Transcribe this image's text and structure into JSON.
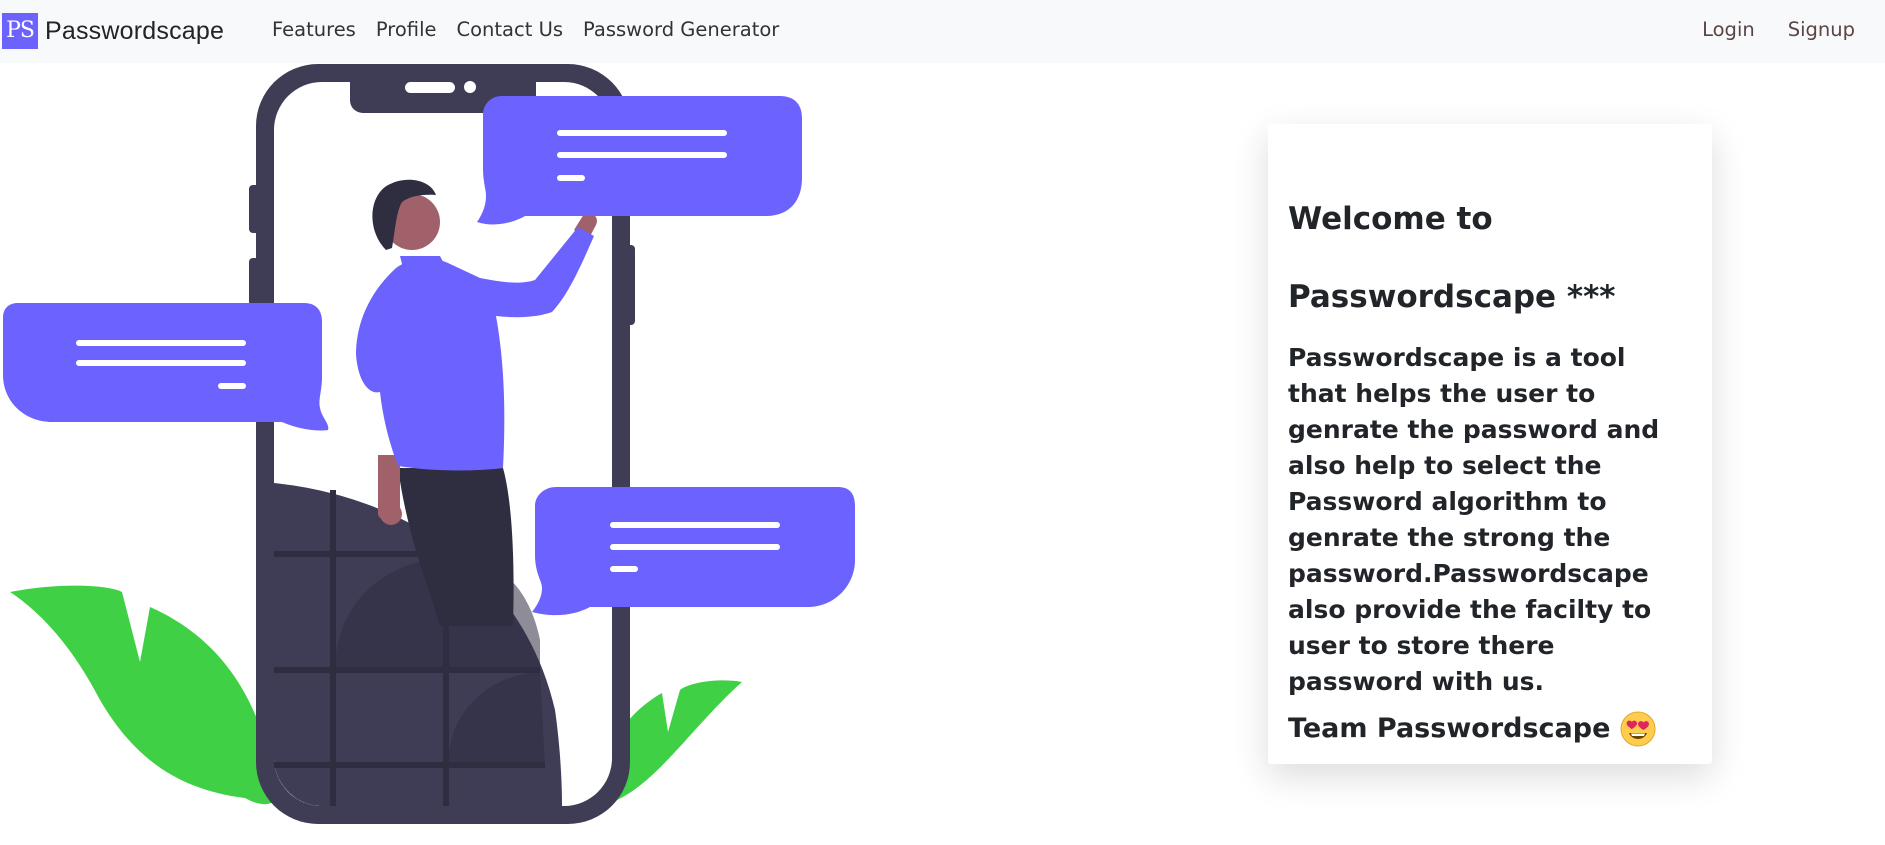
{
  "brand": {
    "logo_text": "PS",
    "name": "Passwordscape"
  },
  "nav": {
    "links": [
      {
        "label": "Features"
      },
      {
        "label": "Profile"
      },
      {
        "label": "Contact Us"
      },
      {
        "label": "Password Generator"
      }
    ],
    "auth": {
      "login": "Login",
      "signup": "Signup"
    }
  },
  "card": {
    "title_line1": "Welcome to",
    "title_line2": "Passwordscape ***",
    "body": "Passwordscape is a tool that helps the user to genrate the password and also help to select the Password algorithm to genrate the strong the password.Passwordscape also provide the facilty to user to store there password with us.",
    "signoff": "Team Passwordscape",
    "signoff_emoji": "smiling-face-with-heart-eyes-icon"
  },
  "colors": {
    "accent": "#6c63ff",
    "phone": "#3f3d56",
    "leaf": "#3fd046",
    "skin": "#a0616a",
    "navbar_bg": "#f8f9fa"
  }
}
